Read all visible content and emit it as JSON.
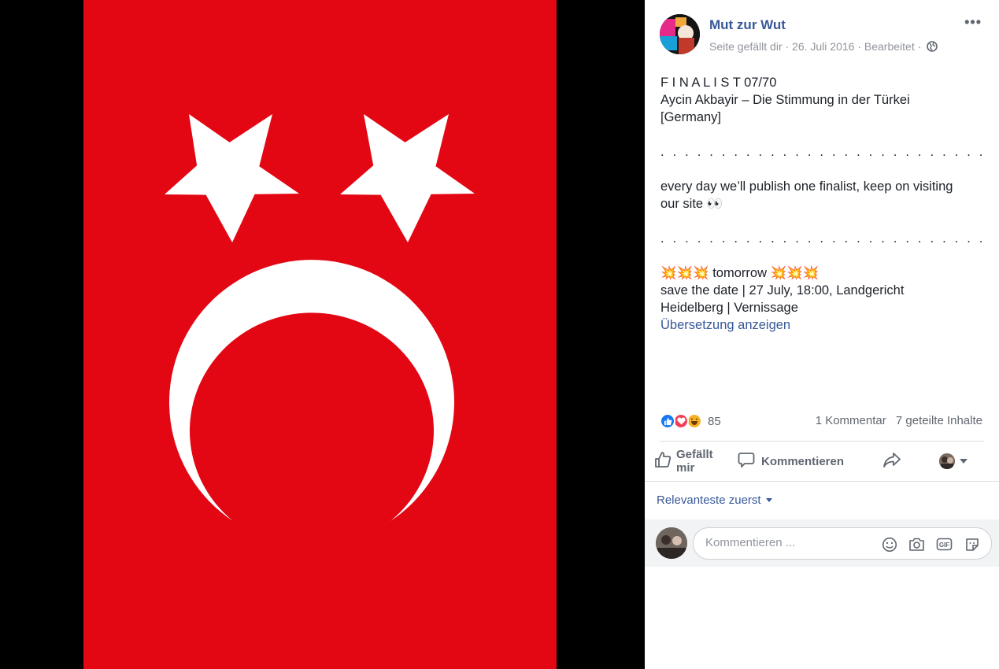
{
  "post": {
    "page_name": "Mut zur Wut",
    "meta": "Seite gefällt dir · 26. Juli 2016 · Bearbeitet · ",
    "more_label": "•••",
    "lines": {
      "l1": "F I N A L I S T 07/70",
      "l2": "Aycin Akbayir – Die Stimmung in der Türkei",
      "l3": "[Germany]",
      "dots1": ". . . . . . . . . . . . . . . . . . . . . . . . . . . . . . . . . . . . . . . .",
      "l4": "every day we’ll publish one finalist, keep on visiting",
      "l5": "our site 👀",
      "dots2": ". . . . . . . . . . . . . . . . . . . . . . . . . . . . . . . . . . . . . . . .",
      "l6": "💥💥💥 tomorrow 💥💥💥",
      "l7": "save the date | 27 July, 18:00, Landgericht",
      "l8": "Heidelberg | Vernissage"
    },
    "see_translation": "Übersetzung anzeigen"
  },
  "reactions": {
    "count": "85",
    "comments": "1 Kommentar",
    "shares": "7 geteilte Inhalte"
  },
  "actions": {
    "like_line1": "Gefällt",
    "like_line2": "mir",
    "comment": "Kommentieren"
  },
  "sort_label": "Relevanteste zuerst",
  "composer": {
    "placeholder": "Kommentieren ..."
  },
  "colors": {
    "flag_red": "#e30613",
    "link_blue": "#385898"
  },
  "icons": [
    "globe-icon",
    "like-reaction-icon",
    "love-reaction-icon",
    "haha-reaction-icon",
    "thumbs-up-icon",
    "speech-bubble-icon",
    "share-arrow-icon",
    "emoji-icon",
    "camera-icon",
    "gif-icon",
    "sticker-icon"
  ]
}
